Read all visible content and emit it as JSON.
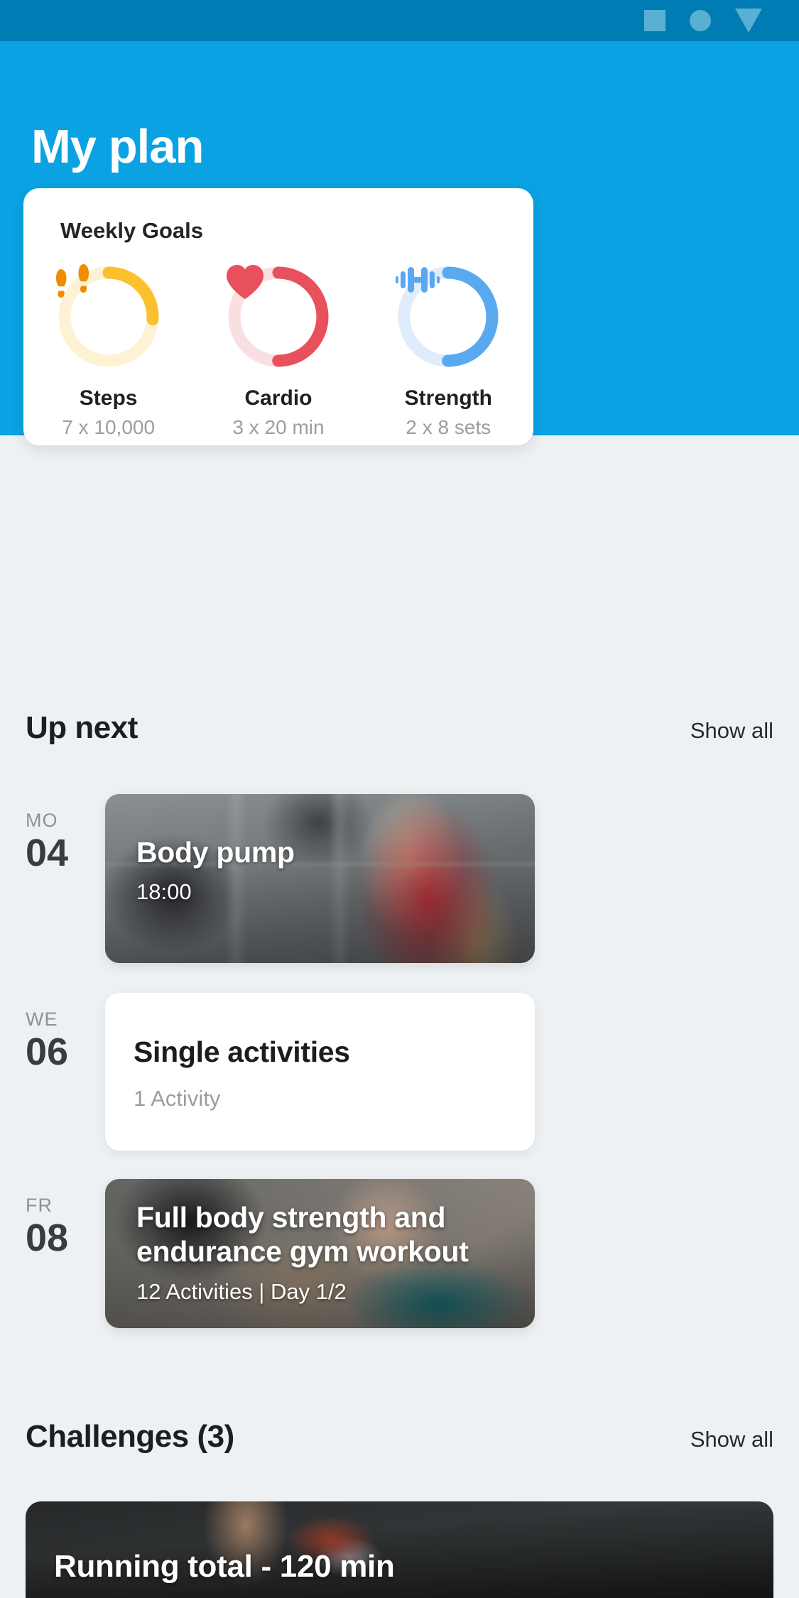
{
  "statusbar": {
    "icons": [
      "square-icon",
      "circle-icon",
      "triangle-down-icon"
    ]
  },
  "header": {
    "title": "My plan"
  },
  "weekly_goals": {
    "title": "Weekly Goals",
    "items": [
      {
        "label": "Steps",
        "value": "7 x 10,000",
        "icon": "footprints-icon",
        "progress": 26,
        "color": "#fbc02d",
        "track": "#fdf3d4"
      },
      {
        "label": "Cardio",
        "value": "3 x 20 min",
        "icon": "heart-icon",
        "progress": 50,
        "color": "#e8505b",
        "track": "#fadfe1"
      },
      {
        "label": "Strength",
        "value": "2 x 8 sets",
        "icon": "dumbbell-icon",
        "progress": 50,
        "color": "#5aa9f0",
        "track": "#dfecfb"
      }
    ]
  },
  "up_next": {
    "title": "Up next",
    "show_all": "Show all",
    "entries": [
      {
        "dow": "MO",
        "day": "04",
        "title": "Body pump",
        "subtitle": "18:00",
        "style": "photo"
      },
      {
        "dow": "WE",
        "day": "06",
        "title": "Single activities",
        "subtitle": "1 Activity",
        "style": "plain"
      },
      {
        "dow": "FR",
        "day": "08",
        "title": "Full body strength and endurance gym workout",
        "subtitle": "12 Activities | Day 1/2",
        "style": "photo"
      }
    ]
  },
  "challenges": {
    "title": "Challenges (3)",
    "show_all": "Show all",
    "entries": [
      {
        "title": "Running total - 120 min"
      }
    ]
  },
  "colors": {
    "brand_blue": "#0aa2e2",
    "statusbar_blue": "#007cb5",
    "page_bg": "#eef1f4",
    "card_white": "#ffffff"
  }
}
